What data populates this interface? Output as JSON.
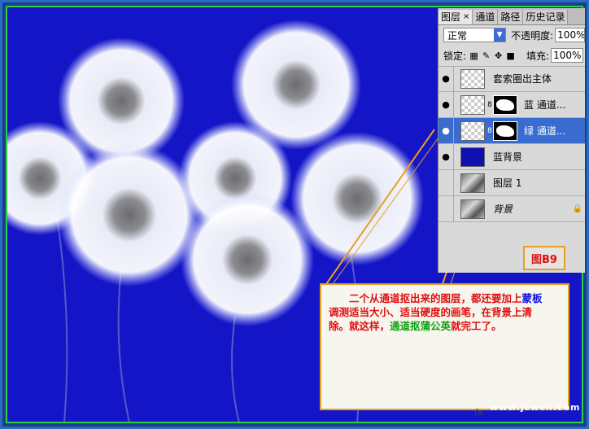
{
  "panel": {
    "tabs": [
      {
        "label": "图层",
        "close": "×"
      },
      {
        "label": "通道"
      },
      {
        "label": "路径"
      },
      {
        "label": "历史记录"
      }
    ],
    "blend_mode": "正常",
    "opacity_label": "不透明度:",
    "opacity_value": "100%",
    "lock_label": "锁定:",
    "fill_label": "填充:",
    "fill_value": "100%",
    "layers": [
      {
        "name": "套索圈出主体",
        "visible": true
      },
      {
        "name": "蓝  通道...",
        "visible": true
      },
      {
        "name": "绿  通道...",
        "visible": true,
        "selected": true
      },
      {
        "name": "蓝背景",
        "visible": true
      },
      {
        "name": "图层 1",
        "visible": false
      },
      {
        "name": "背景",
        "visible": false
      }
    ]
  },
  "figure_label": "图B9",
  "note": {
    "line1_a": "二个从通道抠出来的图层，都还要加上",
    "line1_b": "蒙板",
    "line2": "调测适当大小、适当硬度的画笔，在背景上清",
    "line3_a": "除。就这样，",
    "line3_b": "通道抠蒲公英",
    "line3_c": "就完工了。"
  },
  "watermark": "www.jcwcn.com",
  "colors": {
    "background_blue": "#1515c8",
    "selected_layer": "#3a6cd0",
    "note_border": "#e8a020"
  }
}
